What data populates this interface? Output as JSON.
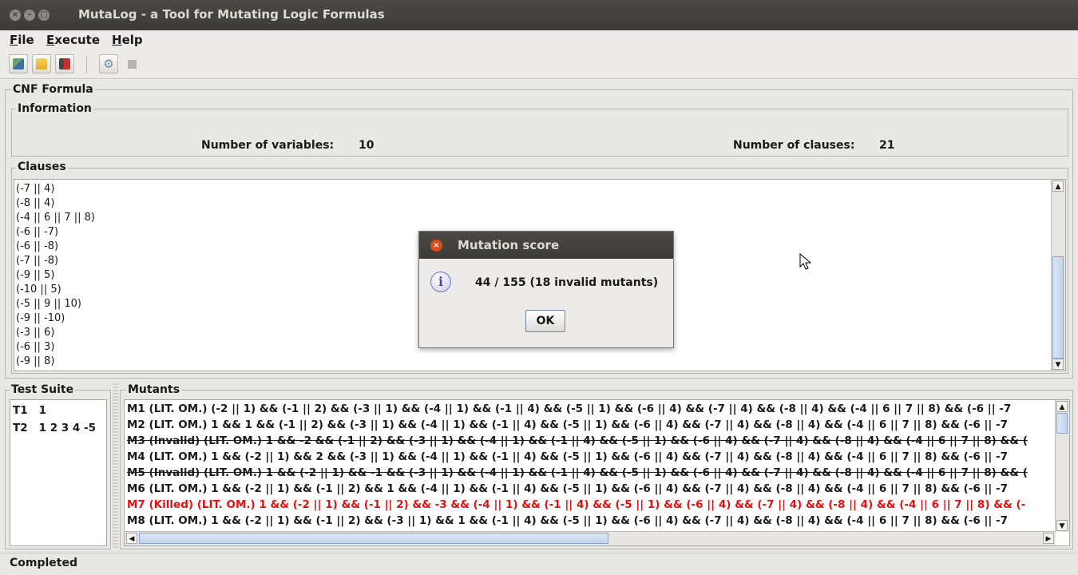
{
  "window": {
    "title": "MutaLog - a Tool for Mutating Logic Formulas"
  },
  "menu": {
    "file": "File",
    "execute": "Execute",
    "help": "Help"
  },
  "toolbar": {
    "icons": [
      "open-file-icon",
      "open-folder-icon",
      "exit-icon",
      "gear-icon",
      "stop-icon"
    ]
  },
  "cnf": {
    "title": "CNF Formula",
    "information": {
      "title": "Information",
      "vars_label": "Number of variables:",
      "vars_value": "10",
      "clauses_label": "Number of clauses:",
      "clauses_value": "21"
    },
    "clauses": {
      "title": "Clauses",
      "items": [
        "(-7 || 4)",
        "(-8 || 4)",
        "(-4 || 6 || 7 || 8)",
        "(-6 || -7)",
        "(-6 || -8)",
        "(-7 || -8)",
        "(-9 || 5)",
        "(-10 || 5)",
        "(-5 || 9 || 10)",
        "(-9 || -10)",
        "(-3 || 6)",
        "(-6 || 3)",
        "(-9 || 8)"
      ]
    }
  },
  "test_suite": {
    "title": "Test Suite",
    "items": [
      {
        "id": "T1",
        "value": "1"
      },
      {
        "id": "T2",
        "value": "1 2 3 4 -5"
      }
    ]
  },
  "mutants": {
    "title": "Mutants",
    "items": [
      {
        "text": "M1   (LIT. OM.)   (-2 || 1) && (-1 || 2) && (-3 || 1) && (-4 || 1) && (-1 || 4) && (-5 || 1) && (-6 || 4) && (-7 || 4) && (-8 || 4) && (-4 || 6 || 7 || 8) && (-6 || -7",
        "style": "normal"
      },
      {
        "text": "M2   (LIT. OM.)   1 && 1 && (-1 || 2) && (-3 || 1) && (-4 || 1) && (-1 || 4) && (-5 || 1) && (-6 || 4) && (-7 || 4) && (-8 || 4) && (-4 || 6 || 7 || 8) && (-6 || -7",
        "style": "normal"
      },
      {
        "text": "M3 (Invalid) (LIT. OM.) 1 && -2 && (-1 || 2) && (-3 || 1) && (-4 || 1) && (-1 || 4) && (-5 || 1) && (-6 || 4) && (-7 || 4) && (-8 || 4) && (-4 || 6 || 7 || 8) && (",
        "style": "invalid"
      },
      {
        "text": "M4   (LIT. OM.)   1 && (-2 || 1) && 2 && (-3 || 1) && (-4 || 1) && (-1 || 4) && (-5 || 1) && (-6 || 4) && (-7 || 4) && (-8 || 4) && (-4 || 6 || 7 || 8) && (-6 || -7",
        "style": "normal"
      },
      {
        "text": "M5 (Invalid) (LIT. OM.) 1 && (-2 || 1) && -1 && (-3 || 1) && (-4 || 1) && (-1 || 4) && (-5 || 1) && (-6 || 4) && (-7 || 4) && (-8 || 4) && (-4 || 6 || 7 || 8) && (",
        "style": "invalid"
      },
      {
        "text": "M6   (LIT. OM.)   1 && (-2 || 1) && (-1 || 2) && 1 && (-4 || 1) && (-1 || 4) && (-5 || 1) && (-6 || 4) && (-7 || 4) && (-8 || 4) && (-4 || 6 || 7 || 8) && (-6 || -7",
        "style": "normal"
      },
      {
        "text": "M7 (Killed) (LIT. OM.) 1 && (-2 || 1) && (-1 || 2) && -3 && (-4 || 1) && (-1 || 4) && (-5 || 1) && (-6 || 4) && (-7 || 4) && (-8 || 4) && (-4 || 6 || 7 || 8) && (-",
        "style": "killed"
      },
      {
        "text": "M8   (LIT. OM.)   1 && (-2 || 1) && (-1 || 2) && (-3 || 1) && 1 && (-1 || 4) && (-5 || 1) && (-6 || 4) && (-7 || 4) && (-8 || 4) && (-4 || 6 || 7 || 8) && (-6 || -7",
        "style": "normal"
      }
    ]
  },
  "status": {
    "text": "Completed"
  },
  "dialog": {
    "title": "Mutation score",
    "message": "44 / 155 (18 invalid mutants)",
    "ok": "OK"
  }
}
